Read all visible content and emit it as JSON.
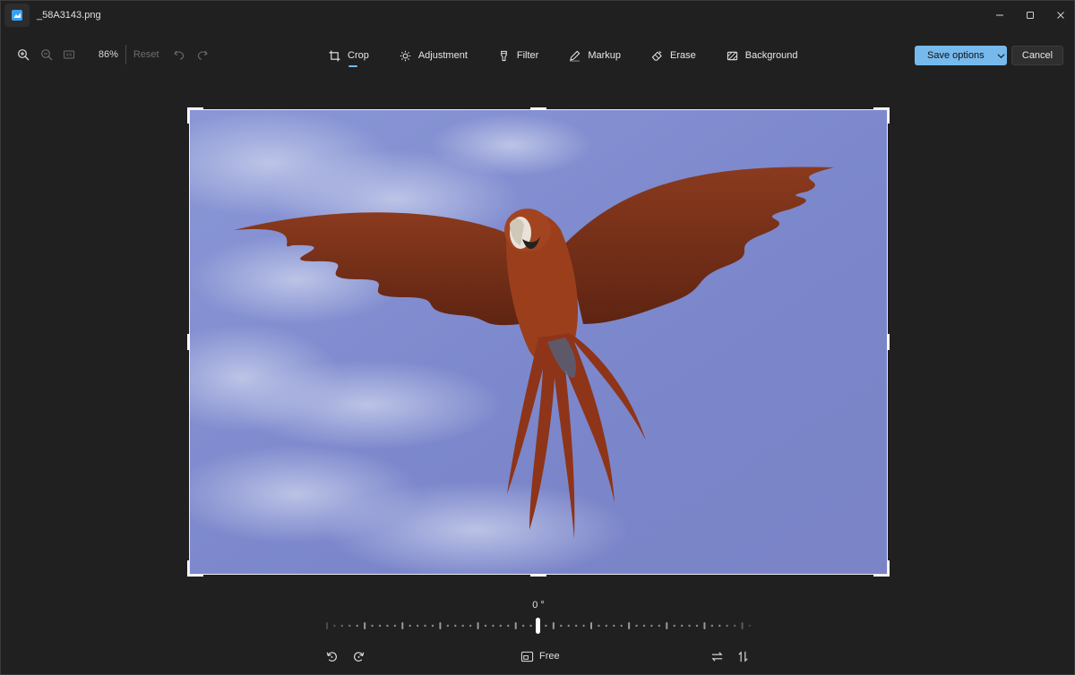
{
  "window": {
    "title": "_58A3143.png"
  },
  "zoom": {
    "percent": "86%",
    "reset_label": "Reset"
  },
  "tabs": [
    {
      "label": "Crop",
      "icon": "crop-icon",
      "active": true
    },
    {
      "label": "Adjustment",
      "icon": "brightness-icon",
      "active": false
    },
    {
      "label": "Filter",
      "icon": "filter-icon",
      "active": false
    },
    {
      "label": "Markup",
      "icon": "pen-icon",
      "active": false
    },
    {
      "label": "Erase",
      "icon": "eraser-icon",
      "active": false
    },
    {
      "label": "Background",
      "icon": "background-icon",
      "active": false
    }
  ],
  "actions": {
    "save_label": "Save options",
    "cancel_label": "Cancel"
  },
  "crop": {
    "angle_label": "0 °",
    "straighten_value": 0,
    "aspect_label": "Free"
  },
  "colors": {
    "accent": "#76b9ed",
    "background": "#202020",
    "sky": "#7c87cc"
  }
}
